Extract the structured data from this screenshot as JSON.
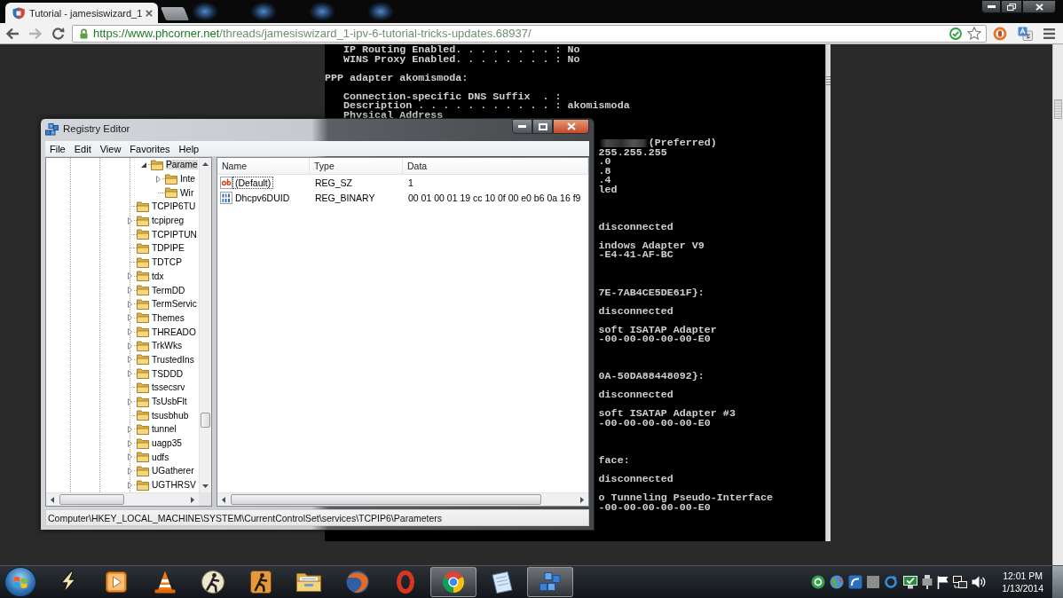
{
  "browser": {
    "tabs": [
      {
        "title": "Tutorial - jamesiswizard_1",
        "selected": true
      }
    ],
    "back": {
      "disabled": false
    },
    "forward": {
      "disabled": true
    },
    "address": {
      "origin": "https://www.phcorner.net",
      "path": "/threads/jamesiswizard_1-ipv-6-tutorial-tricks-updates.68937/"
    },
    "bookmarked": false
  },
  "console": {
    "blocks": [
      {
        "kind": "field",
        "lines": [
          "IP Routing Enabled. . . . . . . . : No",
          "WINS Proxy Enabled. . . . . . . . : No"
        ]
      },
      {
        "kind": "heading",
        "lines": [
          "PPP adapter akomismoda:"
        ]
      },
      {
        "kind": "field",
        "lines": [
          "Connection-specific DNS Suffix  . :",
          "Description . . . . . . . . . . . : akomismoda",
          "Physical Address"
        ]
      }
    ],
    "line_ends": [
      [
        {
          "smudged_start": true,
          "lines": [
            "(Preferred)",
            "255.255.255",
            ".0",
            ".8",
            ".4",
            "led"
          ]
        }
      ],
      [
        {
          "smudged_start": false,
          "lines": [
            "disconnected"
          ]
        },
        {
          "smudged_start": false,
          "lines": [
            "indows Adapter V9",
            "-E4-41-AF-BC"
          ]
        }
      ],
      [
        {
          "smudged_start": false,
          "lines": [
            "7E-7AB4CE5DE61F}:"
          ]
        },
        {
          "smudged_start": false,
          "lines": [
            "disconnected"
          ]
        },
        {
          "smudged_start": false,
          "lines": [
            "soft ISATAP Adapter",
            "-00-00-00-00-00-E0"
          ]
        }
      ],
      [
        {
          "smudged_start": false,
          "lines": [
            "0A-50DA88448092}:"
          ]
        },
        {
          "smudged_start": false,
          "lines": [
            "disconnected"
          ]
        },
        {
          "smudged_start": false,
          "lines": [
            "soft ISATAP Adapter #3",
            "-00-00-00-00-00-E0"
          ]
        }
      ],
      [
        {
          "smudged_start": false,
          "lines": [
            "face:"
          ]
        },
        {
          "smudged_start": false,
          "lines": [
            "disconnected"
          ]
        },
        {
          "smudged_start": false,
          "lines": [
            "o Tunneling Pseudo-Interface",
            "-00-00-00-00-00-E0"
          ]
        }
      ]
    ]
  },
  "registry_editor": {
    "title": "Registry Editor",
    "menu": [
      "File",
      "Edit",
      "View",
      "Favorites",
      "Help"
    ],
    "tree": {
      "branch_tail": [
        {
          "label": "Parame",
          "has_children": true,
          "expanded": true,
          "selected": true,
          "children": [
            {
              "label": "Inte",
              "has_children": true,
              "expanded": false,
              "selected": false
            },
            {
              "label": "Wir",
              "has_children": false,
              "selected": false
            }
          ]
        }
      ],
      "items": [
        {
          "label": "TCPIP6TU",
          "has_children": false,
          "selected": false
        },
        {
          "label": "tcpipreg",
          "has_children": true,
          "expanded": false,
          "selected": false
        },
        {
          "label": "TCPIPTUN",
          "has_children": false,
          "selected": false
        },
        {
          "label": "TDPIPE",
          "has_children": false,
          "selected": false
        },
        {
          "label": "TDTCP",
          "has_children": false,
          "selected": false
        },
        {
          "label": "tdx",
          "has_children": true,
          "expanded": false,
          "selected": false
        },
        {
          "label": "TermDD",
          "has_children": true,
          "expanded": false,
          "selected": false
        },
        {
          "label": "TermServic",
          "has_children": true,
          "expanded": false,
          "selected": false
        },
        {
          "label": "Themes",
          "has_children": true,
          "expanded": false,
          "selected": false
        },
        {
          "label": "THREADO",
          "has_children": true,
          "expanded": false,
          "selected": false
        },
        {
          "label": "TrkWks",
          "has_children": true,
          "expanded": false,
          "selected": false
        },
        {
          "label": "TrustedIns",
          "has_children": true,
          "expanded": false,
          "selected": false
        },
        {
          "label": "TSDDD",
          "has_children": true,
          "expanded": false,
          "selected": false
        },
        {
          "label": "tssecsrv",
          "has_children": false,
          "selected": false
        },
        {
          "label": "TsUsbFlt",
          "has_children": true,
          "expanded": false,
          "selected": false
        },
        {
          "label": "tsusbhub",
          "has_children": false,
          "selected": false
        },
        {
          "label": "tunnel",
          "has_children": true,
          "expanded": false,
          "selected": false
        },
        {
          "label": "uagp35",
          "has_children": true,
          "expanded": false,
          "selected": false
        },
        {
          "label": "udfs",
          "has_children": true,
          "expanded": false,
          "selected": false
        },
        {
          "label": "UGatherer",
          "has_children": true,
          "expanded": false,
          "selected": false
        },
        {
          "label": "UGTHRSV",
          "has_children": true,
          "expanded": false,
          "selected": false
        }
      ]
    },
    "columns": [
      "Name",
      "Type",
      "Data"
    ],
    "values": [
      {
        "kind": "string",
        "name": "(Default)",
        "type": "REG_SZ",
        "data": "1",
        "focused": true
      },
      {
        "kind": "binary",
        "name": "Dhcpv6DUID",
        "type": "REG_BINARY",
        "data": "00 01 00 01 19 cc 10 0f 00 e0 b6 0a 16 f9",
        "focused": false
      }
    ],
    "status": "Computer\\HKEY_LOCAL_MACHINE\\SYSTEM\\CurrentControlSet\\services\\TCPIP6\\Parameters"
  },
  "taskbar": {
    "apps": [
      {
        "kind": "bolt",
        "running": false
      },
      {
        "kind": "play",
        "running": false
      },
      {
        "kind": "cone",
        "running": false
      },
      {
        "kind": "figure",
        "running": false
      },
      {
        "kind": "figure-tile",
        "running": false
      },
      {
        "kind": "folder",
        "running": false
      },
      {
        "kind": "globe",
        "running": false
      },
      {
        "kind": "ring",
        "running": false
      },
      {
        "kind": "wheel",
        "running": true
      },
      {
        "kind": "notepad",
        "running": false
      },
      {
        "kind": "cubes",
        "running": true
      }
    ],
    "clock": {
      "time": "12:01 PM",
      "date": "1/13/2014"
    }
  }
}
